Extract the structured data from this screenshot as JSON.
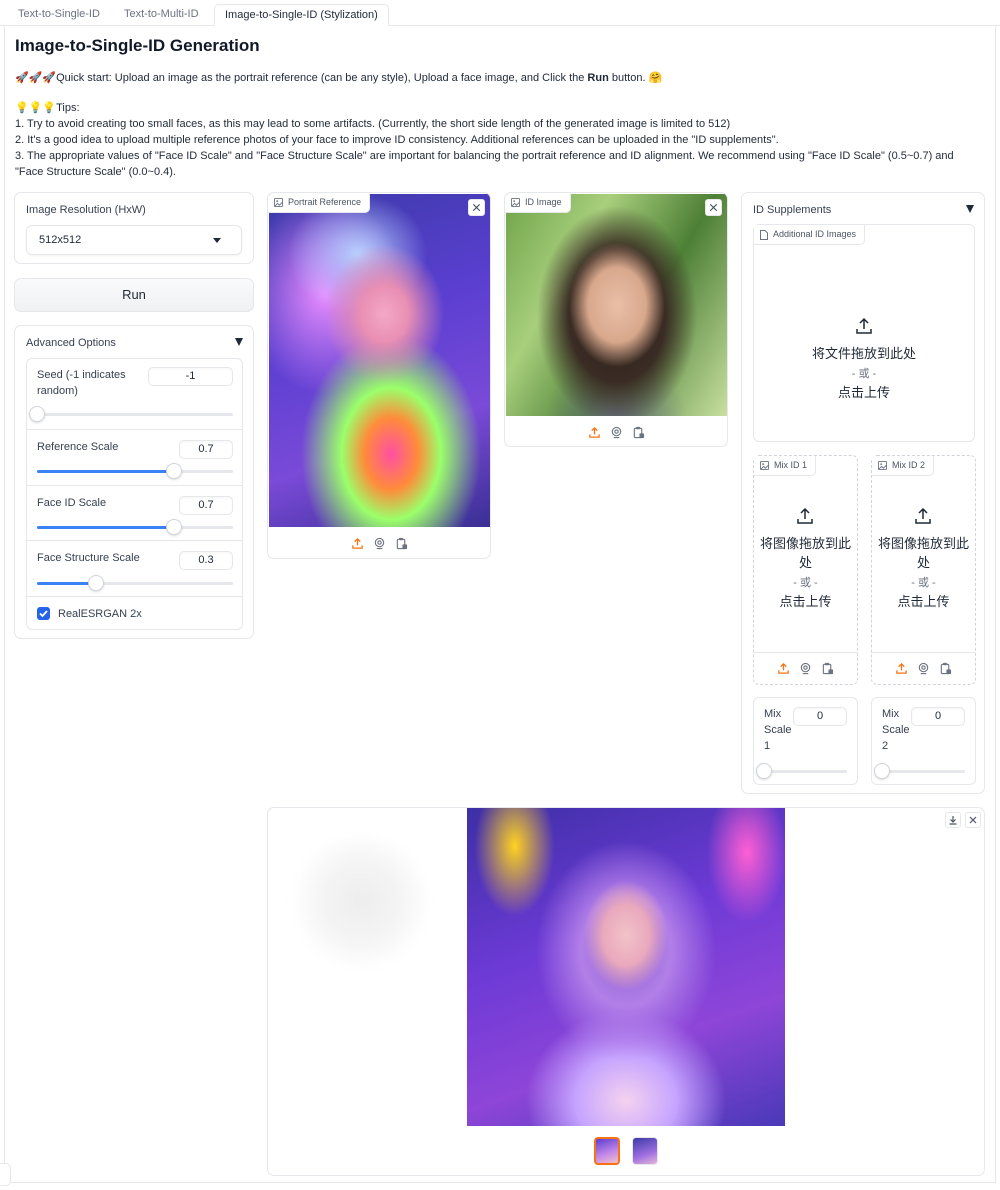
{
  "tabs": [
    {
      "label": "Text-to-Single-ID"
    },
    {
      "label": "Text-to-Multi-ID"
    },
    {
      "label": "Image-to-Single-ID (Stylization)"
    }
  ],
  "page": {
    "title": "Image-to-Single-ID Generation",
    "quick_start_emoji": "🚀🚀🚀",
    "quick_start_pre": "Quick start: Upload an image as the portrait reference (can be any style), Upload a face image, and Click the ",
    "quick_start_bold": "Run",
    "quick_start_post": " button. 🤗",
    "tips_header": "💡💡💡Tips:",
    "tips": [
      "1. Try to avoid creating too small faces, as this may lead to some artifacts. (Currently, the short side length of the generated image is limited to 512)",
      "2. It's a good idea to upload multiple reference photos of your face to improve ID consistency. Additional references can be uploaded in the \"ID supplements\".",
      "3. The appropriate values of \"Face ID Scale\" and \"Face Structure Scale\" are important for balancing the portrait reference and ID alignment. We recommend using \"Face ID Scale\" (0.5~0.7) and \"Face Structure Scale\" (0.0~0.4)."
    ]
  },
  "resolution": {
    "label": "Image Resolution (HxW)",
    "value": "512x512"
  },
  "run_button": {
    "label": "Run"
  },
  "advanced": {
    "title": "Advanced Options",
    "seed": {
      "label": "Seed (-1 indicates random)",
      "value": "-1",
      "fraction": 0.0
    },
    "reference_scale": {
      "label": "Reference Scale",
      "value": "0.7",
      "fraction": 0.7
    },
    "face_id_scale": {
      "label": "Face ID Scale",
      "value": "0.7",
      "fraction": 0.7
    },
    "face_structure_scale": {
      "label": "Face Structure Scale",
      "value": "0.3",
      "fraction": 0.3
    },
    "realesrgan": {
      "label": "RealESRGAN 2x",
      "checked": true
    }
  },
  "portrait_reference": {
    "label": "Portrait Reference"
  },
  "id_image": {
    "label": "ID Image"
  },
  "id_supplements": {
    "title": "ID Supplements",
    "additional": {
      "label": "Additional ID Images",
      "drop_text": "将文件拖放到此处",
      "or_text": "- 或 -",
      "click_text": "点击上传"
    },
    "mix1": {
      "label": "Mix ID 1",
      "drop_line1": "将图像拖放到此",
      "drop_line2": "处",
      "or_text": "- 或 -",
      "click_text": "点击上传"
    },
    "mix2": {
      "label": "Mix ID 2",
      "drop_line1": "将图像拖放到此",
      "drop_line2": "处",
      "or_text": "- 或 -",
      "click_text": "点击上传"
    },
    "mix_scale1": {
      "label_line1": "Mix",
      "label_line2": "Scale",
      "label_line3": "1",
      "value": "0",
      "fraction": 0.0
    },
    "mix_scale2": {
      "label_line1": "Mix",
      "label_line2": "Scale",
      "label_line3": "2",
      "value": "0",
      "fraction": 0.0
    }
  },
  "colors": {
    "accent": "#f97316",
    "slider": "#3b82f6",
    "checkbox": "#2563eb"
  }
}
